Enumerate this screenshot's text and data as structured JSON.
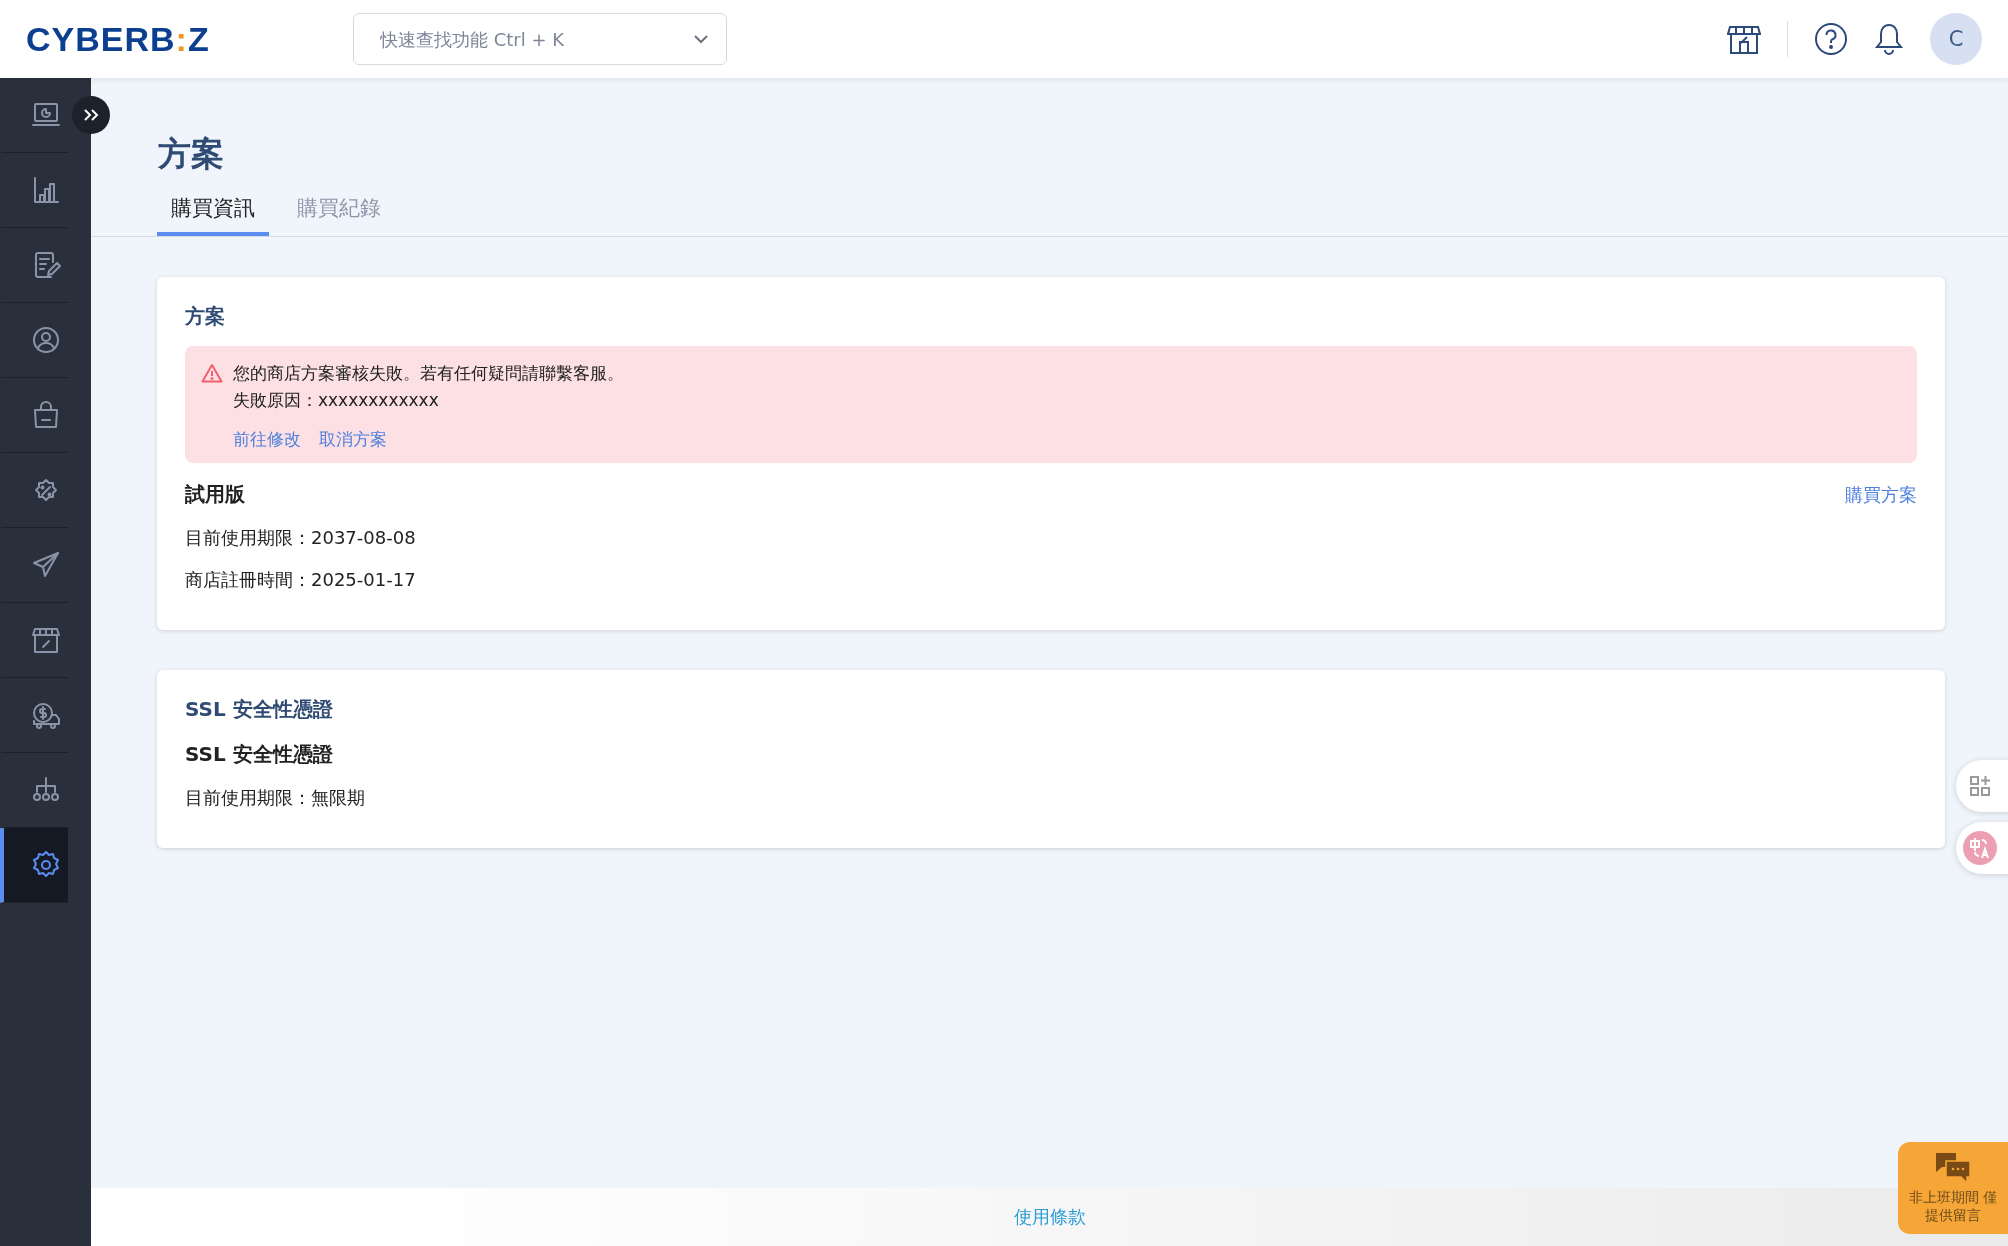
{
  "header": {
    "logo": {
      "before": "CYBERB",
      "mark": ":",
      "after": "Z"
    },
    "search": {
      "placeholder": "快速查找功能 Ctrl + K"
    },
    "avatar": "C"
  },
  "sidebar": {
    "items": [
      {
        "selected": false
      },
      {
        "selected": false
      },
      {
        "selected": false
      },
      {
        "selected": false
      },
      {
        "selected": false
      },
      {
        "selected": false
      },
      {
        "selected": false
      },
      {
        "selected": false
      },
      {
        "selected": false
      },
      {
        "selected": false
      },
      {
        "selected": true
      }
    ]
  },
  "page": {
    "title": "方案",
    "tabs": [
      {
        "label": "購買資訊",
        "selected": true
      },
      {
        "label": "購買紀錄",
        "selected": false
      }
    ]
  },
  "plan_card": {
    "title": "方案",
    "alert": {
      "message": "您的商店方案審核失敗。若有任何疑問請聯繫客服。",
      "reason": "失敗原因：xxxxxxxxxxxx",
      "actions": [
        "前往修改",
        "取消方案"
      ]
    },
    "plan_name": "試用版",
    "buy_link": "購買方案",
    "details": [
      "目前使用期限：2037-08-08",
      "商店註冊時間：2025-01-17"
    ]
  },
  "ssl_card": {
    "title": "SSL 安全性憑證",
    "name": "SSL 安全性憑證",
    "details": [
      "目前使用期限：無限期"
    ]
  },
  "footer": {
    "link": "使用條款"
  },
  "chat_widget": {
    "lines": [
      "非上班期間 僅",
      "提供留言"
    ]
  }
}
